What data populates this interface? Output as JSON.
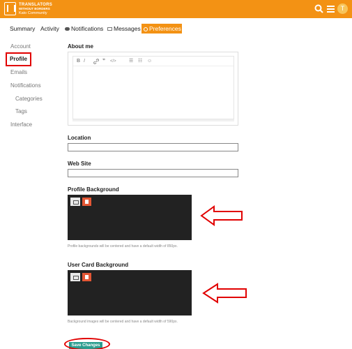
{
  "header": {
    "logo_line1": "TRANSLATORS",
    "logo_line2": "WITHOUT BORDERS",
    "logo_line3": "Kato Community",
    "avatar_letter": "T",
    "colors": {
      "brand": "#f39214"
    }
  },
  "tabs": [
    {
      "label": "Summary"
    },
    {
      "label": "Activity"
    },
    {
      "label": "Notifications",
      "icon": "chat-bubble-icon"
    },
    {
      "label": "Messages",
      "icon": "envelope-icon"
    },
    {
      "label": "Preferences",
      "icon": "gear-icon",
      "active": true
    }
  ],
  "sidebar": {
    "items": [
      {
        "label": "Account"
      },
      {
        "label": "Profile",
        "active": true
      },
      {
        "label": "Emails"
      },
      {
        "label": "Notifications"
      },
      {
        "label": "Categories"
      },
      {
        "label": "Tags"
      },
      {
        "label": "Interface"
      }
    ]
  },
  "form": {
    "about_label": "About me",
    "toolbar": [
      "B",
      "I",
      "link",
      "quote",
      "code",
      "bullet-list",
      "numbered-list",
      "emoji"
    ],
    "about_value": "",
    "location_label": "Location",
    "location_value": "",
    "website_label": "Web Site",
    "website_value": "",
    "profile_bg_label": "Profile Background",
    "profile_bg_hint": "Profile backgrounds will be centered and have a default width of 850px.",
    "card_bg_label": "User Card Background",
    "card_bg_hint": "Background images will be centered and have a default width of 590px.",
    "save_label": "Save Changes"
  },
  "annotations": {
    "highlight_color": "#e10000"
  }
}
